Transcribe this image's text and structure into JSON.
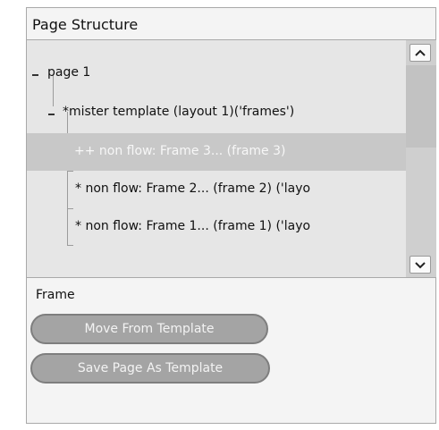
{
  "panel": {
    "title": "Page Structure"
  },
  "tree": {
    "items": [
      {
        "toggle": "collapse",
        "label": "page 1"
      },
      {
        "toggle": "collapse",
        "label": "*mister template (layout 1)('frames')"
      },
      {
        "label": "++ non flow: Frame 3... (frame 3)",
        "selected": true
      },
      {
        "label": "* non flow: Frame 2... (frame 2) ('layo"
      },
      {
        "label": "* non flow: Frame 1... (frame 1) ('layo"
      }
    ]
  },
  "scrollbar": {
    "up_icon": "chevron-up-icon",
    "down_icon": "chevron-down-icon"
  },
  "frame_section": {
    "label": "Frame",
    "buttons": {
      "move_from_template": "Move From Template",
      "save_page_as_template": "Save Page As Template"
    }
  }
}
